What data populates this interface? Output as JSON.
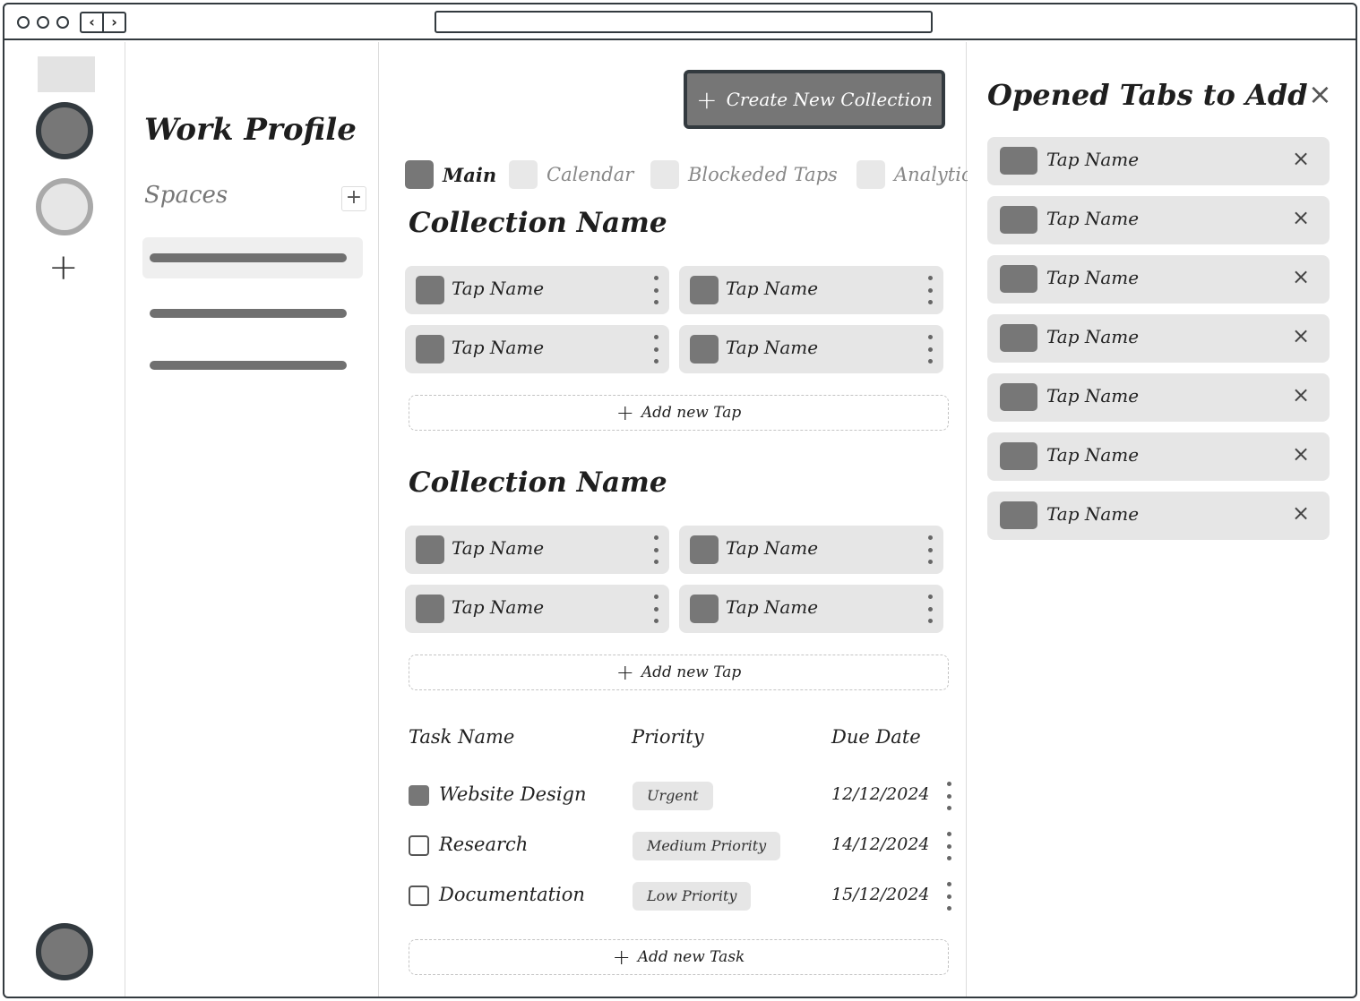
{
  "sidebar": {
    "profile_title": "Work Profile",
    "spaces_label": "Spaces",
    "spaces_add": "+"
  },
  "main": {
    "create_button": "Create New Collection",
    "tabs": [
      {
        "label": "Main"
      },
      {
        "label": "Calendar"
      },
      {
        "label": "Blockeded Taps"
      },
      {
        "label": "Analytics"
      }
    ],
    "collections": [
      {
        "title": "Collection Name",
        "taps": [
          "Tap Name",
          "Tap Name",
          "Tap Name",
          "Tap Name"
        ],
        "add_label": "Add new Tap"
      },
      {
        "title": "Collection Name",
        "taps": [
          "Tap Name",
          "Tap Name",
          "Tap Name",
          "Tap Name"
        ],
        "add_label": "Add new Tap"
      }
    ],
    "tasks": {
      "headers": {
        "name": "Task Name",
        "priority": "Priority",
        "due": "Due Date"
      },
      "rows": [
        {
          "name": "Website Design",
          "priority": "Urgent",
          "due": "12/12/2024",
          "checked": true
        },
        {
          "name": "Research",
          "priority": "Medium Priority",
          "due": "14/12/2024",
          "checked": false
        },
        {
          "name": "Documentation",
          "priority": "Low Priority",
          "due": "15/12/2024",
          "checked": false
        }
      ],
      "add_label": "Add new Task"
    }
  },
  "panel": {
    "title": "Opened Tabs to Add",
    "close": "×",
    "tabs": [
      "Tap Name",
      "Tap Name",
      "Tap Name",
      "Tap Name",
      "Tap Name",
      "Tap Name",
      "Tap Name"
    ]
  },
  "icons": {
    "plus": "+",
    "close": "×",
    "back": "‹",
    "forward": "›"
  }
}
